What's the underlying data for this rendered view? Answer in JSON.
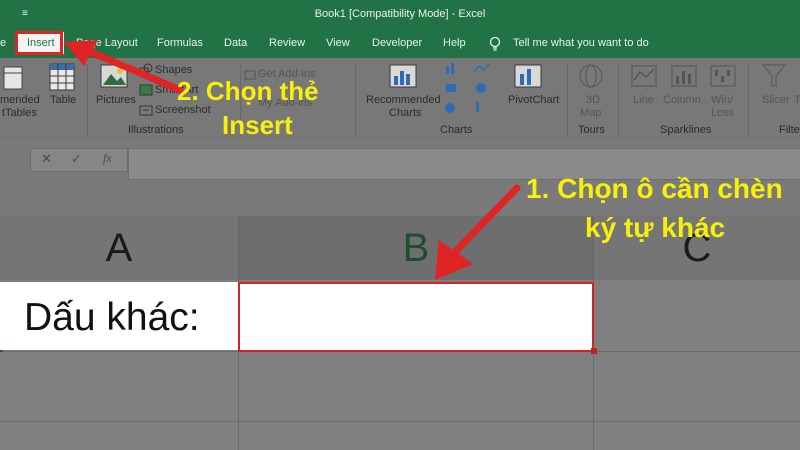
{
  "window": {
    "title": "Book1  [Compatibility Mode]  -  Excel",
    "qat": "≡"
  },
  "tabs": [
    {
      "label": "e"
    },
    {
      "label": "Insert"
    },
    {
      "label": "Page Layout"
    },
    {
      "label": "Formulas"
    },
    {
      "label": "Data"
    },
    {
      "label": "Review"
    },
    {
      "label": "View"
    },
    {
      "label": "Developer"
    },
    {
      "label": "Help"
    },
    {
      "label": "Tell me what you want to do"
    }
  ],
  "ribbon": {
    "recommended_pivot": "Recommended\nPivotTables",
    "rec_pivot_a": "mended",
    "rec_pivot_b": "tTables",
    "table": "Table",
    "pictures": "Pictures",
    "shapes": "Shapes",
    "smartart": "SmartArt",
    "screenshot": "Screenshot",
    "get_addins": "Get Add-ins",
    "my_addins": "My Add-ins",
    "recommended_charts_a": "Recommended",
    "recommended_charts_b": "Charts",
    "pivotchart": "PivotChart",
    "map3d_a": "3D",
    "map3d_b": "Map",
    "line": "Line",
    "column": "Column",
    "winloss_a": "Win/",
    "winloss_b": "Loss",
    "slicer": "Slicer",
    "ti": "Ti",
    "groups": {
      "illustrations": "Illustrations",
      "charts": "Charts",
      "tours": "Tours",
      "sparklines": "Sparklines",
      "filters": "Filte"
    }
  },
  "formula_bar": {
    "cancel": "✕",
    "enter": "✓",
    "fx": "fx"
  },
  "columns": [
    {
      "label": "A"
    },
    {
      "label": "B"
    },
    {
      "label": "C"
    }
  ],
  "cells": {
    "A": "Dấu khác:",
    "B": ""
  },
  "annotations": {
    "step2_line1": "2. Chọn thẻ",
    "step2_line2": "Insert",
    "step1_line1": "1. Chọn ô cần chèn",
    "step1_line2": "ký tự khác"
  },
  "colors": {
    "excel_green": "#217346",
    "highlight_red": "#e02424",
    "annotation_yellow": "#f7f00a"
  }
}
